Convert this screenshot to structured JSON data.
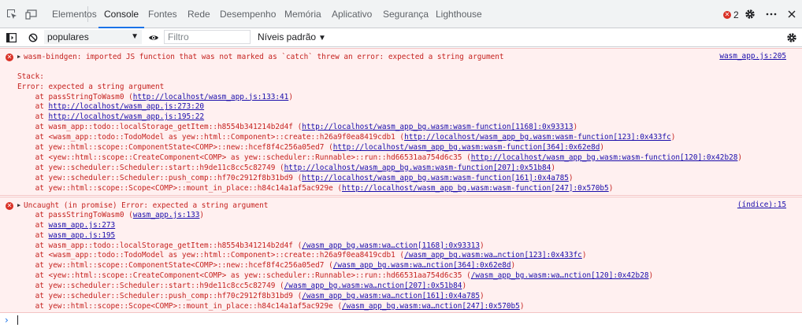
{
  "tabs": [
    "Elementos",
    "Console",
    "Fontes",
    "Rede",
    "Desempenho",
    "Memória",
    "Aplicativo",
    "Segurança",
    "Lighthouse"
  ],
  "active_tab": "Console",
  "error_count": "2",
  "toolbar": {
    "context": "populares",
    "filter_placeholder": "Filtro",
    "levels": "Níveis padrão"
  },
  "messages": [
    {
      "source": "wasm_app.js:205",
      "lines": [
        {
          "text": "wasm-bindgen: imported JS function that was not marked as `catch` threw an error: expected a string argument"
        },
        {
          "text": ""
        },
        {
          "text": "Stack:"
        },
        {
          "text": "Error: expected a string argument"
        },
        {
          "text": "    at passStringToWasm0 (",
          "link": "http://localhost/wasm_app.js:133:41",
          "after": ")"
        },
        {
          "text": "    at ",
          "link": "http://localhost/wasm_app.js:273:20",
          "after": ""
        },
        {
          "text": "    at ",
          "link": "http://localhost/wasm_app.js:195:22",
          "after": ""
        },
        {
          "text": "    at wasm_app::todo::localStorage_getItem::h8554b341214b2d4f (",
          "link": "http://localhost/wasm_app_bg.wasm:wasm-function[1168]:0x93313",
          "after": ")"
        },
        {
          "text": "    at <wasm_app::todo::TodoModel as yew::html::Component>::create::h26a9f0ea8419cdb1 (",
          "link": "http://localhost/wasm_app_bg.wasm:wasm-function[123]:0x433fc",
          "after": ")"
        },
        {
          "text": "    at yew::html::scope::ComponentState<COMP>::new::hcef8f4c256a05ed7 (",
          "link": "http://localhost/wasm_app_bg.wasm:wasm-function[364]:0x62e8d",
          "after": ")"
        },
        {
          "text": "    at <yew::html::scope::CreateComponent<COMP> as yew::scheduler::Runnable>::run::hd66531aa754d6c35 (",
          "link": "http://localhost/wasm_app_bg.wasm:wasm-function[120]:0x42b28",
          "after": ")"
        },
        {
          "text": "    at yew::scheduler::Scheduler::start::h9de11c8cc5c82749 (",
          "link": "http://localhost/wasm_app_bg.wasm:wasm-function[207]:0x51b84",
          "after": ")"
        },
        {
          "text": "    at yew::scheduler::Scheduler::push_comp::hf70c2912f8b31bd9 (",
          "link": "http://localhost/wasm_app_bg.wasm:wasm-function[161]:0x4a785",
          "after": ")"
        },
        {
          "text": "    at yew::html::scope::Scope<COMP>::mount_in_place::h84c14a1af5ac929e (",
          "link": "http://localhost/wasm_app_bg.wasm:wasm-function[247]:0x570b5",
          "after": ")"
        }
      ]
    },
    {
      "source": "(índice):15",
      "lines": [
        {
          "text": "Uncaught (in promise) Error: expected a string argument"
        },
        {
          "text": "    at passStringToWasm0 (",
          "link": "wasm_app.js:133",
          "after": ")"
        },
        {
          "text": "    at ",
          "link": "wasm_app.js:273",
          "after": ""
        },
        {
          "text": "    at ",
          "link": "wasm_app.js:195",
          "after": ""
        },
        {
          "text": "    at wasm_app::todo::localStorage_getItem::h8554b341214b2d4f (",
          "link": "/wasm_app_bg.wasm:wa…ction[1168]:0x93313",
          "after": ")"
        },
        {
          "text": "    at <wasm_app::todo::TodoModel as yew::html::Component>::create::h26a9f0ea8419cdb1 (",
          "link": "/wasm_app_bg.wasm:wa…nction[123]:0x433fc",
          "after": ")"
        },
        {
          "text": "    at yew::html::scope::ComponentState<COMP>::new::hcef8f4c256a05ed7 (",
          "link": "/wasm_app_bg.wasm:wa…nction[364]:0x62e8d",
          "after": ")"
        },
        {
          "text": "    at <yew::html::scope::CreateComponent<COMP> as yew::scheduler::Runnable>::run::hd66531aa754d6c35 (",
          "link": "/wasm_app_bg.wasm:wa…nction[120]:0x42b28",
          "after": ")"
        },
        {
          "text": "    at yew::scheduler::Scheduler::start::h9de11c8cc5c82749 (",
          "link": "/wasm_app_bg.wasm:wa…nction[207]:0x51b84",
          "after": ")"
        },
        {
          "text": "    at yew::scheduler::Scheduler::push_comp::hf70c2912f8b31bd9 (",
          "link": "/wasm_app_bg.wasm:wa…nction[161]:0x4a785",
          "after": ")"
        },
        {
          "text": "    at yew::html::scope::Scope<COMP>::mount_in_place::h84c14a1af5ac929e (",
          "link": "/wasm_app_bg.wasm:wa…nction[247]:0x570b5",
          "after": ")"
        }
      ]
    }
  ]
}
